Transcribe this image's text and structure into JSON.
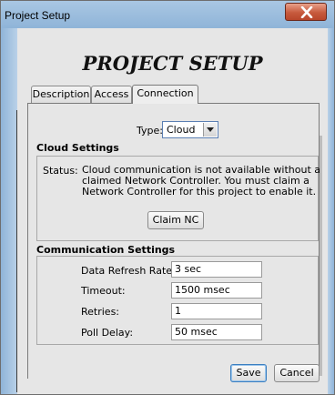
{
  "window": {
    "title": "Project Setup"
  },
  "heading": "PROJECT SETUP",
  "tabs": [
    {
      "label": "Description",
      "active": false
    },
    {
      "label": "Access",
      "active": false
    },
    {
      "label": "Connection",
      "active": true
    }
  ],
  "connection": {
    "type_label": "Type:",
    "type_value": "Cloud"
  },
  "cloud_settings": {
    "title": "Cloud Settings",
    "status_label": "Status:",
    "status_message": "Cloud communication is not available without a claimed Network Controller. You must claim a Network Controller for this project to enable it.",
    "claim_button": "Claim NC"
  },
  "communication_settings": {
    "title": "Communication Settings",
    "fields": [
      {
        "label": "Data Refresh Rate:",
        "value": "3 sec"
      },
      {
        "label": "Timeout:",
        "value": "1500 msec"
      },
      {
        "label": "Retries:",
        "value": "1"
      },
      {
        "label": "Poll Delay:",
        "value": "50 msec"
      }
    ]
  },
  "buttons": {
    "save": "Save",
    "cancel": "Cancel"
  },
  "colors": {
    "titlebar": "#9dbfdf",
    "close_button": "#c75a3d",
    "client_bg": "#e6e6e6"
  },
  "icons": {
    "close": "close-icon",
    "dropdown": "chevron-down-icon"
  }
}
